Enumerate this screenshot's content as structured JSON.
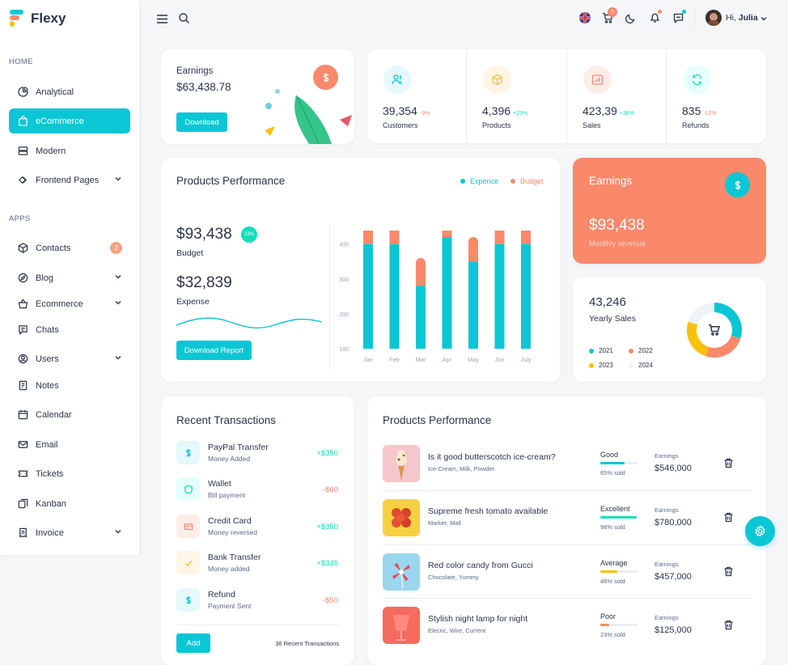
{
  "brand": {
    "name": "Flexy"
  },
  "sidebar": {
    "home_label": "HOME",
    "apps_label": "APPS",
    "home_items": [
      {
        "label": "Analytical",
        "icon": "pie-chart-icon"
      },
      {
        "label": "eCommerce",
        "icon": "shopping-bag-icon",
        "active": true
      },
      {
        "label": "Modern",
        "icon": "server-icon"
      },
      {
        "label": "Frontend Pages",
        "icon": "layers-icon",
        "chevron": true
      }
    ],
    "app_items": [
      {
        "label": "Contacts",
        "icon": "box-icon",
        "badge": "2"
      },
      {
        "label": "Blog",
        "icon": "compass-icon",
        "chevron": true
      },
      {
        "label": "Ecommerce",
        "icon": "basket-icon",
        "chevron": true
      },
      {
        "label": "Chats",
        "icon": "message-icon"
      },
      {
        "label": "Users",
        "icon": "user-circle-icon",
        "chevron": true
      },
      {
        "label": "Notes",
        "icon": "notes-icon"
      },
      {
        "label": "Calendar",
        "icon": "calendar-icon"
      },
      {
        "label": "Email",
        "icon": "mail-icon"
      },
      {
        "label": "Tickets",
        "icon": "ticket-icon"
      },
      {
        "label": "Kanban",
        "icon": "kanban-icon"
      },
      {
        "label": "Invoice",
        "icon": "invoice-icon",
        "chevron": true
      }
    ]
  },
  "topbar": {
    "cart_badge": "0",
    "greeting": "Hi,",
    "user_name": "Julia"
  },
  "earnings_card": {
    "title": "Earnings",
    "value": "$63,438.78",
    "button": "Download"
  },
  "stats": [
    {
      "value": "39,354",
      "change": "-9%",
      "label": "Customers",
      "icon": "users-icon",
      "color": "#0bc6d4",
      "bg": "#e5f8fa",
      "positive": false
    },
    {
      "value": "4,396",
      "change": "+23%",
      "label": "Products",
      "icon": "cube-icon",
      "color": "#f8c43b",
      "bg": "#fef5e5",
      "positive": true
    },
    {
      "value": "423,39",
      "change": "+38%",
      "label": "Sales",
      "icon": "bar-chart-icon",
      "color": "#fa896b",
      "bg": "#fdede8",
      "positive": true
    },
    {
      "value": "835",
      "change": "-12%",
      "label": "Refunds",
      "icon": "refresh-icon",
      "color": "#13deb9",
      "bg": "#e6fffa",
      "positive": false
    }
  ],
  "products_performance": {
    "title": "Products Performance",
    "legend": [
      "Expence",
      "Budget"
    ],
    "budget_value": "$93,438",
    "budget_badge": "23%",
    "budget_label": "Budget",
    "expense_value": "$32,839",
    "expense_label": "Expense",
    "button": "Download Report"
  },
  "chart_data": {
    "type": "bar",
    "categories": [
      "Jan",
      "Feb",
      "Mar",
      "Apr",
      "May",
      "Jun",
      "July"
    ],
    "series": [
      {
        "name": "Expence",
        "values": [
          300,
          300,
          180,
          320,
          250,
          300,
          300
        ]
      },
      {
        "name": "Budget",
        "values": [
          60,
          90,
          80,
          60,
          70,
          100,
          80
        ]
      }
    ],
    "stacked": true,
    "yticks": [
      "100",
      "200",
      "300",
      "400"
    ],
    "ylim": [
      100,
      420
    ],
    "colors": {
      "Expence": "#0bc6d4",
      "Budget": "#fa896b"
    }
  },
  "earnings_big": {
    "title": "Earnings",
    "value": "$93,438",
    "subtitle": "Monthly revenue"
  },
  "yearly_sales": {
    "value": "43,246",
    "label": "Yearly Sales",
    "legend": [
      "2021",
      "2022",
      "2023",
      "2024"
    ],
    "donut": [
      {
        "year": "2021",
        "value": 30,
        "color": "#0bc6d4"
      },
      {
        "year": "2022",
        "value": 25,
        "color": "#fa896b"
      },
      {
        "year": "2023",
        "value": 25,
        "color": "#f8c20a"
      },
      {
        "year": "2024",
        "value": 20,
        "color": "#eef3f8"
      }
    ]
  },
  "transactions": {
    "title": "Recent Transactions",
    "items": [
      {
        "title": "PayPal Transfer",
        "sub": "Money Added",
        "amount": "+$350",
        "positive": true,
        "icon": "dollar-icon",
        "color": "#0bc6d4",
        "bg": "#e5f8fa"
      },
      {
        "title": "Wallet",
        "sub": "Bill payment",
        "amount": "-$60",
        "positive": false,
        "icon": "shield-icon",
        "color": "#13deb9",
        "bg": "#e6fffa"
      },
      {
        "title": "Credit Card",
        "sub": "Money reversed",
        "amount": "+$350",
        "positive": true,
        "icon": "credit-card-icon",
        "color": "#fa896b",
        "bg": "#fdede8"
      },
      {
        "title": "Bank Transfer",
        "sub": "Money added",
        "amount": "+$345",
        "positive": true,
        "icon": "check-icon",
        "color": "#f8c20a",
        "bg": "#fef5e5"
      },
      {
        "title": "Refund",
        "sub": "Payment Sent",
        "amount": "-$50",
        "positive": false,
        "icon": "dollar-icon",
        "color": "#0bc6d4",
        "bg": "#e5f8fa"
      }
    ],
    "button": "Add",
    "footer": "36 Recent Transactions"
  },
  "products_table": {
    "title": "Products Performance",
    "earnings_label": "Earnings",
    "items": [
      {
        "title": "Is it good butterscotch ice-cream?",
        "sub": "Ice-Cream, Milk, Powder",
        "status": "Good",
        "pct": "65% sold",
        "fill": 0.65,
        "bar_color": "#0bc6d4",
        "earnings": "$546,000",
        "img_bg": "#f5c6cb",
        "img": "icecream"
      },
      {
        "title": "Supreme fresh tomato available",
        "sub": "Market, Mall",
        "status": "Excellent",
        "pct": "98% sold",
        "fill": 0.98,
        "bar_color": "#13deb9",
        "earnings": "$780,000",
        "img_bg": "#f5d142",
        "img": "tomato"
      },
      {
        "title": "Red color candy from Gucci",
        "sub": "Chocolate, Yummy",
        "status": "Average",
        "pct": "46% sold",
        "fill": 0.46,
        "bar_color": "#f8c20a",
        "earnings": "$457,000",
        "img_bg": "#9ad6ee",
        "img": "candy"
      },
      {
        "title": "Stylish night lamp for night",
        "sub": "Elecric, Wire, Current",
        "status": "Poor",
        "pct": "23% sold",
        "fill": 0.23,
        "bar_color": "#fa896b",
        "earnings": "$125,000",
        "img_bg": "#f56b5d",
        "img": "lamp"
      }
    ]
  }
}
